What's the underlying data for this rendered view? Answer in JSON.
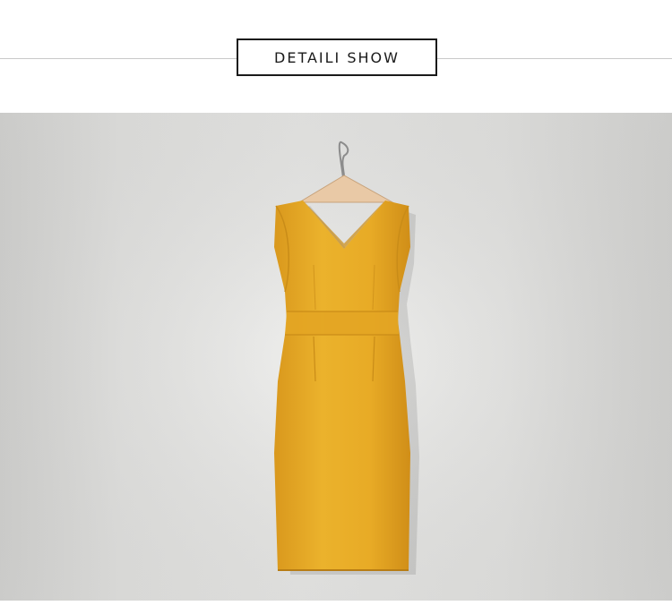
{
  "section": {
    "title": "DETAILI SHOW"
  },
  "product_photo": {
    "subject": "dress-icon",
    "accent_color": "#e8ae2a",
    "background_color": "#e9e9e7"
  }
}
